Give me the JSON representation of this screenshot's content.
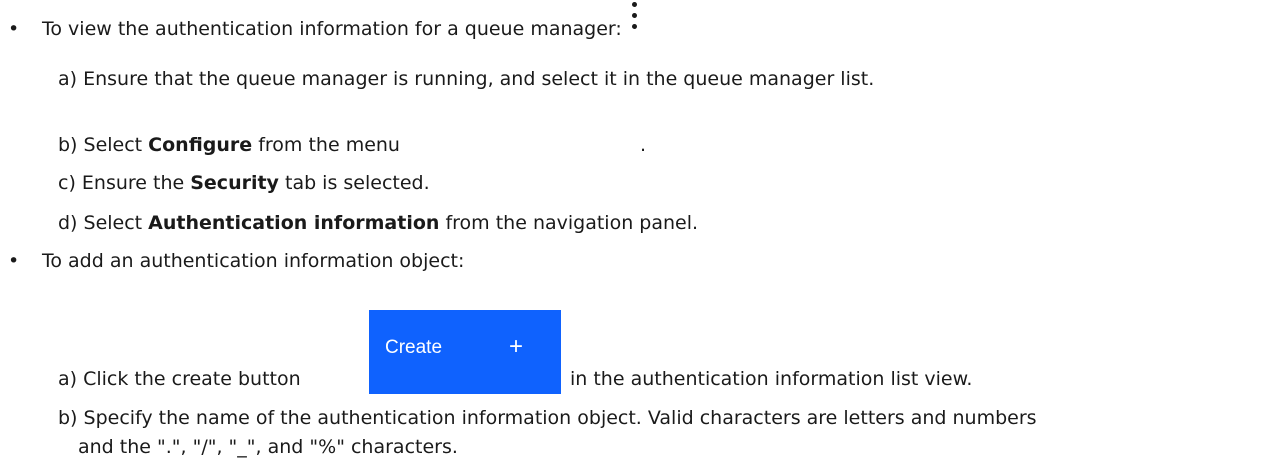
{
  "bullet_char": "•",
  "items": [
    {
      "text": "To view the authentication information for a queue manager:",
      "steps": {
        "a": "a) Ensure that the queue manager is running, and select it in the queue manager list.",
        "b_prefix": "b) Select ",
        "b_bold": "Configure",
        "b_suffix": " from the menu",
        "b_end": ".",
        "c_prefix": "c) Ensure the ",
        "c_bold": "Security",
        "c_suffix": " tab is selected.",
        "d_prefix": "d) Select ",
        "d_bold": "Authentication information",
        "d_suffix": " from the navigation panel."
      }
    },
    {
      "text": "To add an authentication information object:",
      "steps": {
        "a_prefix": "a) Click the create button",
        "a_suffix": "in the authentication information list view.",
        "b_line1": "b) Specify the name of the authentication information object. Valid characters are letters and numbers",
        "b_line2": "and the \".\", \"/\", \"_\", and \"%\" characters."
      }
    }
  ],
  "create_button": {
    "label": "Create",
    "icon": "plus-icon",
    "icon_glyph": "+",
    "color": "#0f62fe"
  },
  "menu_icon": "overflow-menu-vertical-icon"
}
